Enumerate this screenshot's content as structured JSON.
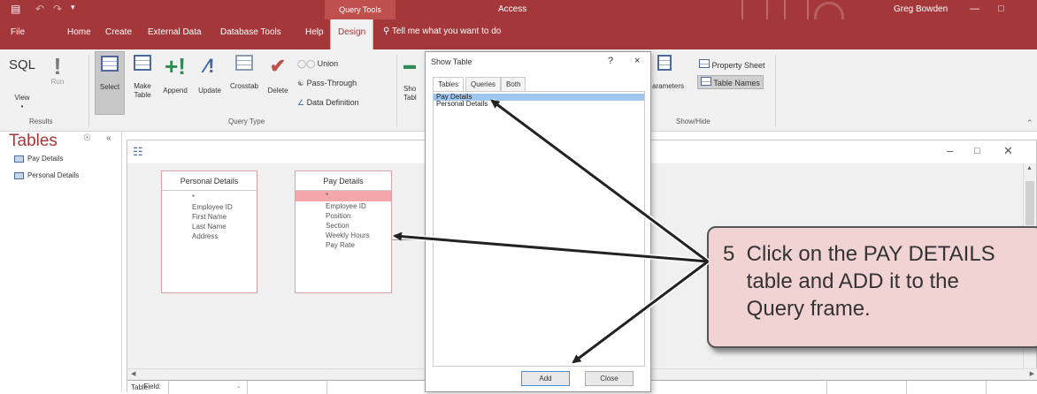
{
  "titlebar": {
    "context_tab": "Query Tools",
    "app_title": "Access",
    "user": "Greg Bowden"
  },
  "tabs": [
    "File",
    "Home",
    "Create",
    "External Data",
    "Database Tools",
    "Help",
    "Design"
  ],
  "active_tab": "Design",
  "tell_me": "Tell me what you want to do",
  "ribbon": {
    "results": {
      "sql_label": "SQL",
      "view_label": "View",
      "run_label": "Run",
      "group_label": "Results"
    },
    "query_type": {
      "buttons": [
        "Select",
        "Make Table",
        "Append",
        "Update",
        "Crosstab",
        "Delete"
      ],
      "small": [
        "Union",
        "Pass-Through",
        "Data Definition"
      ],
      "group_label": "Query Type"
    },
    "show_hide": {
      "partial_left": [
        "Sho",
        "Tabl"
      ],
      "parameters": "arameters",
      "property_sheet": "Property Sheet",
      "table_names": "Table Names",
      "group_label": "Show/Hide"
    }
  },
  "nav": {
    "title": "Tables",
    "items": [
      "Pay Details",
      "Personal Details"
    ]
  },
  "design": {
    "tables": [
      {
        "title": "Personal Details",
        "fields": [
          "*",
          "Employee ID",
          "First Name",
          "Last Name",
          "Address"
        ]
      },
      {
        "title": "Pay Details",
        "fields": [
          "*",
          "Employee ID",
          "Position",
          "Section",
          "Weekly Hours",
          "Pay Rate"
        ]
      }
    ],
    "grid_rows": [
      "Field:",
      "Table:"
    ]
  },
  "dialog": {
    "title": "Show Table",
    "help": "?",
    "close": "×",
    "tabs": [
      "Tables",
      "Queries",
      "Both"
    ],
    "items": [
      "Pay Details",
      "Personal Details"
    ],
    "selected_item": "Pay Details",
    "add_label": "Add",
    "close_label": "Close"
  },
  "callout": {
    "text": "5  Click on the PAY DETAILS\n    table and ADD it to the\n    Query frame."
  }
}
